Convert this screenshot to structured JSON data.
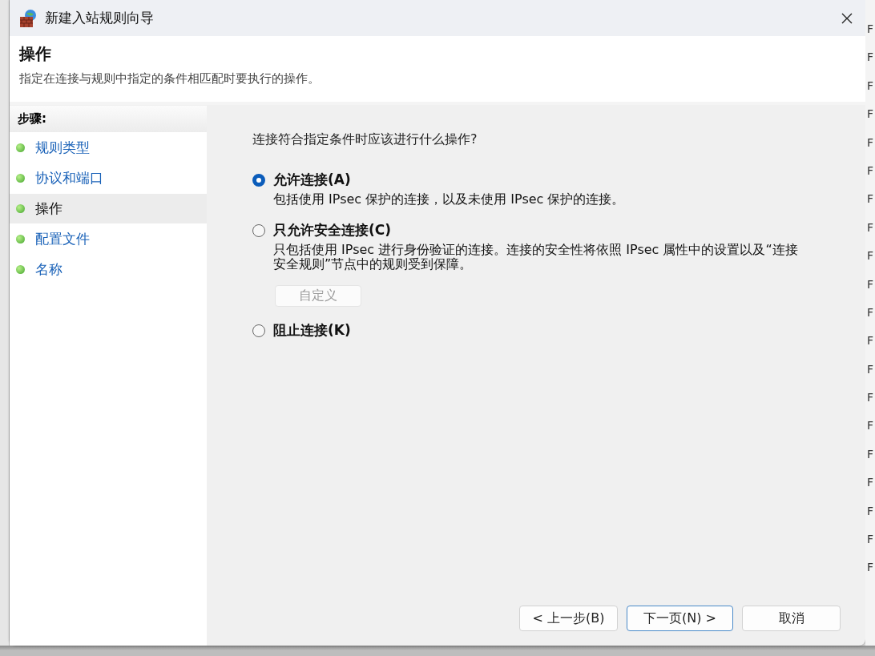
{
  "background_window": {
    "right_edge_marks": [
      "F",
      "F",
      "F",
      "F",
      "F",
      "F",
      "F",
      "F",
      "F",
      "F",
      "F",
      "F",
      "F",
      "F",
      "F",
      "F",
      "F",
      "F",
      "F",
      "F"
    ]
  },
  "window": {
    "title": "新建入站规则向导"
  },
  "header": {
    "title": "操作",
    "description": "指定在连接与规则中指定的条件相匹配时要执行的操作。"
  },
  "steps": {
    "heading": "步骤:",
    "items": [
      {
        "label": "规则类型",
        "selected": false
      },
      {
        "label": "协议和端口",
        "selected": false
      },
      {
        "label": "操作",
        "selected": true
      },
      {
        "label": "配置文件",
        "selected": false
      },
      {
        "label": "名称",
        "selected": false
      }
    ]
  },
  "content": {
    "question": "连接符合指定条件时应该进行什么操作?",
    "options": [
      {
        "label": "允许连接(A)",
        "description": "包括使用 IPsec 保护的连接，以及未使用 IPsec 保护的连接。",
        "selected": true
      },
      {
        "label": "只允许安全连接(C)",
        "description": "只包括使用 IPsec 进行身份验证的连接。连接的安全性将依照 IPsec 属性中的设置以及“连接安全规则”节点中的规则受到保障。",
        "selected": false,
        "button": {
          "label": "自定义",
          "disabled": true
        }
      },
      {
        "label": "阻止连接(K)",
        "selected": false
      }
    ]
  },
  "buttons": [
    {
      "label": "< 上一步(B)",
      "default": false
    },
    {
      "label": "下一页(N) >",
      "default": true
    },
    {
      "label": "取消",
      "default": false
    }
  ]
}
